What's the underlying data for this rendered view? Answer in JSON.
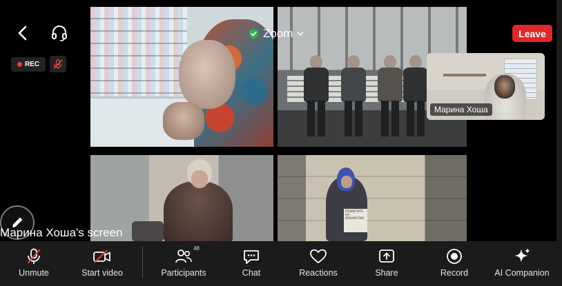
{
  "meeting": {
    "title": "Zoom",
    "leave_label": "Leave",
    "rec_label": "REC",
    "screen_label": "Марина Хоша's screen",
    "self_name": "Марина Хоша"
  },
  "shared_content": {
    "sign_text": "ПОМОГИТЕ НА ЛЕКАРСТВА"
  },
  "toolbar": {
    "items": [
      {
        "label": "Unmute",
        "icon": "mic-muted-icon"
      },
      {
        "label": "Start video",
        "icon": "video-off-icon"
      },
      {
        "label": "Participants",
        "icon": "participants-icon",
        "count": "48"
      },
      {
        "label": "Chat",
        "icon": "chat-icon"
      },
      {
        "label": "Reactions",
        "icon": "heart-icon"
      },
      {
        "label": "Share",
        "icon": "share-icon"
      },
      {
        "label": "Record",
        "icon": "record-icon"
      },
      {
        "label": "AI Companion",
        "icon": "sparkle-icon"
      }
    ]
  },
  "colors": {
    "leave": "#e02828",
    "shield": "#2bb34a",
    "muted": "#e0423a",
    "toolbar_bg": "#1b1b1b"
  }
}
